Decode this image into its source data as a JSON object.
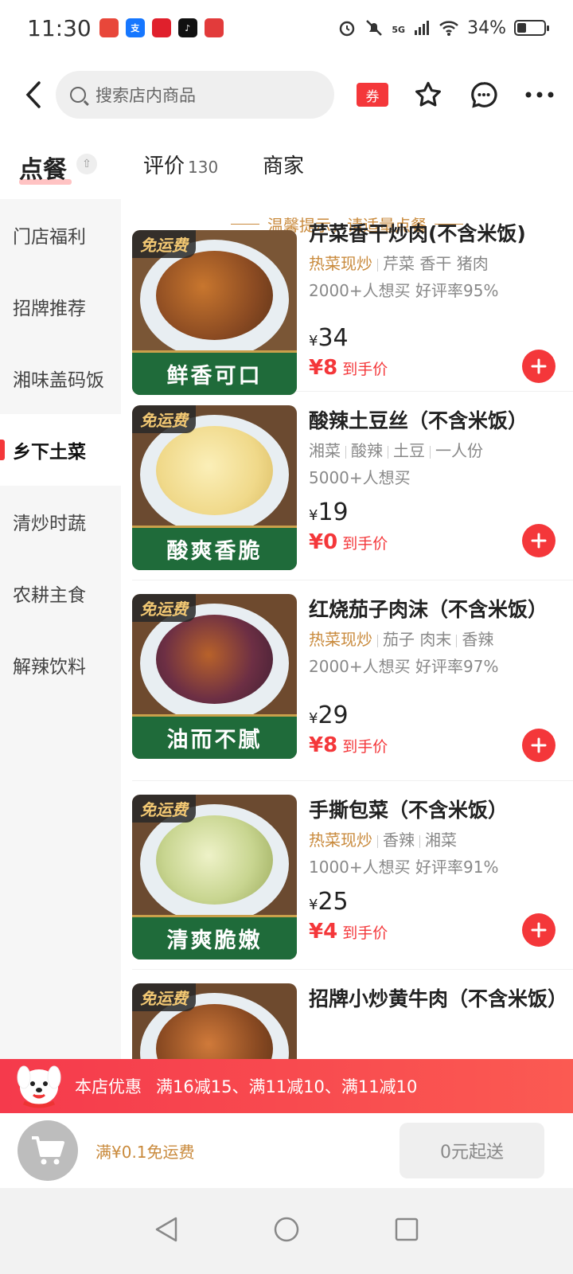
{
  "status_bar": {
    "time": "11:30",
    "battery": "34%",
    "network": "5G",
    "battery_level": 0.34
  },
  "header": {
    "search_placeholder": "搜索店内商品",
    "coupon_label": "券"
  },
  "tabs": [
    {
      "label": "点餐"
    },
    {
      "label": "评价",
      "count": "130"
    },
    {
      "label": "商家"
    }
  ],
  "sidebar": {
    "items": [
      {
        "label": "门店福利"
      },
      {
        "label": "招牌推荐"
      },
      {
        "label": "湘味盖码饭"
      },
      {
        "label": "乡下土菜"
      },
      {
        "label": "清炒时蔬"
      },
      {
        "label": "农耕主食"
      },
      {
        "label": "解辣饮料"
      }
    ]
  },
  "tip": "温馨提示，请适量点餐",
  "items": [
    {
      "name": "芹菜香干炒肉(不含米饭)",
      "badge": "免运费",
      "banner": "鲜香可口",
      "category": "热菜现炒",
      "tags": [
        "芹菜 香干 猪肉"
      ],
      "stats": "2000+人想买 好评率95%",
      "price": "34",
      "deal_price": "8",
      "deal_label": "到手价"
    },
    {
      "name": "酸辣土豆丝（不含米饭）",
      "badge": "免运费",
      "banner": "酸爽香脆",
      "category": "",
      "tags": [
        "湘菜",
        "酸辣",
        "土豆",
        "一人份"
      ],
      "stats": "5000+人想买",
      "price": "19",
      "deal_price": "0",
      "deal_label": "到手价"
    },
    {
      "name": "红烧茄子肉沫（不含米饭）",
      "badge": "免运费",
      "banner": "油而不腻",
      "category": "热菜现炒",
      "tags": [
        "茄子 肉末",
        "香辣"
      ],
      "stats": "2000+人想买 好评率97%",
      "price": "29",
      "deal_price": "8",
      "deal_label": "到手价"
    },
    {
      "name": "手撕包菜（不含米饭）",
      "badge": "免运费",
      "banner": "清爽脆嫩",
      "category": "热菜现炒",
      "tags": [
        "香辣",
        "湘菜"
      ],
      "stats": "1000+人想买 好评率91%",
      "price": "25",
      "deal_price": "4",
      "deal_label": "到手价"
    },
    {
      "name": "招牌小炒黄牛肉（不含米饭）",
      "badge": "免运费"
    }
  ],
  "promo": {
    "title": "本店优惠",
    "text": "满16减15、满11减10、满11减10"
  },
  "cart": {
    "free_shipping": "满¥0.1免运费",
    "min_order": "0元起送"
  },
  "currency": "¥",
  "colors": {
    "accent": "#f4373a",
    "gold": "#c98a3c",
    "banner_green": "#1f6b3a"
  }
}
